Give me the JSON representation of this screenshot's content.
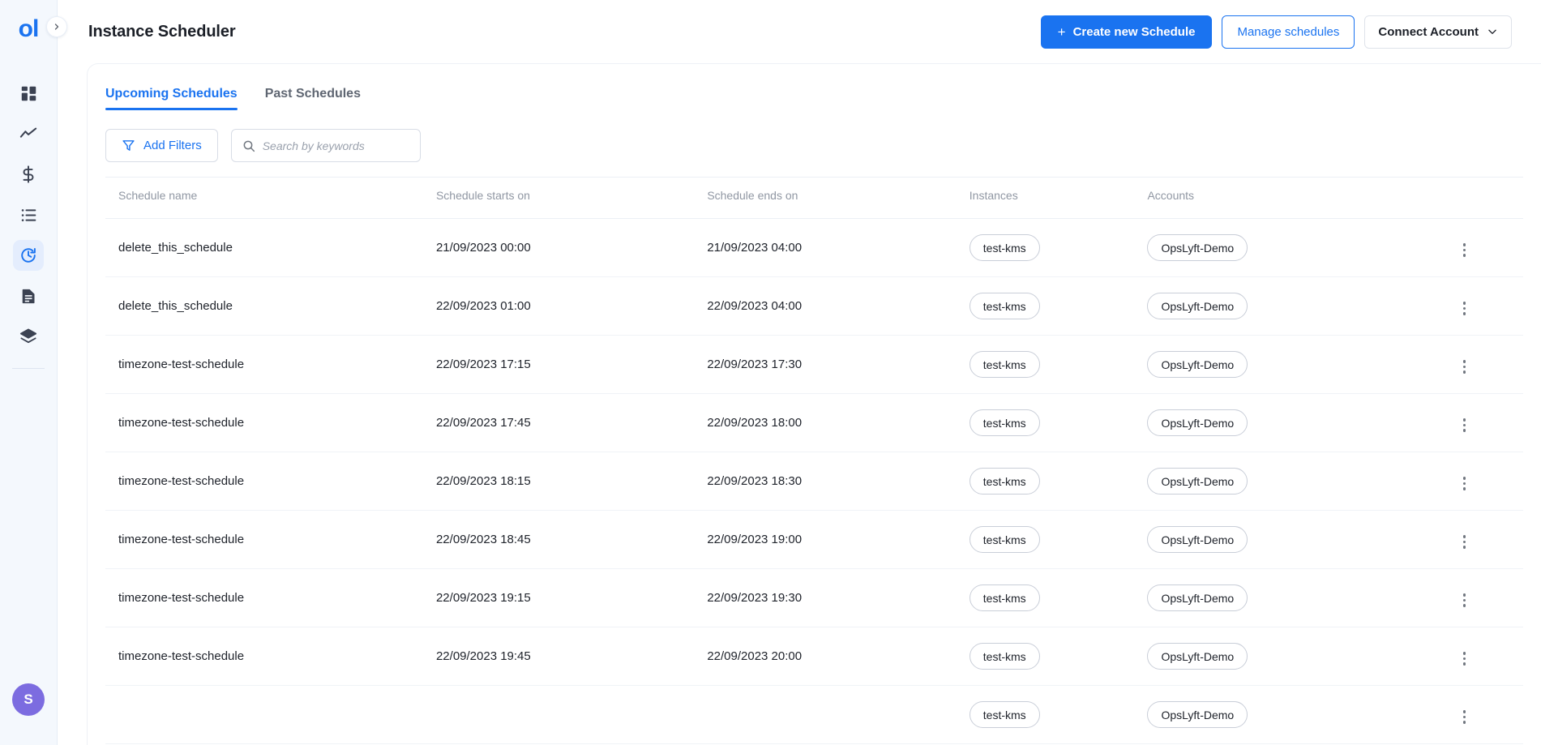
{
  "brand": {
    "logo_text": "ol",
    "expand_icon": "chevron-right-icon"
  },
  "colors": {
    "accent": "#1a73f0",
    "sidebar_bg": "#f4f8fd",
    "active_nav_bg": "#e4edfd",
    "avatar_bg": "#7c6ce0",
    "text": "#20242c",
    "muted": "#9097a3"
  },
  "sidebar": {
    "items": [
      {
        "name": "dashboard",
        "icon": "grid-dashboard-icon",
        "active": false
      },
      {
        "name": "analytics",
        "icon": "trending-line-icon",
        "active": false
      },
      {
        "name": "cost",
        "icon": "dollar-icon",
        "active": false
      },
      {
        "name": "inventory",
        "icon": "list-icon",
        "active": false
      },
      {
        "name": "scheduler",
        "icon": "clock-refresh-icon",
        "active": true
      },
      {
        "name": "reports",
        "icon": "document-icon",
        "active": false
      },
      {
        "name": "resources",
        "icon": "layers-icon",
        "active": false
      }
    ],
    "avatar_initial": "S"
  },
  "header": {
    "title": "Instance Scheduler",
    "create_button": {
      "label": "Create new Schedule",
      "plus": "+"
    },
    "manage_button": {
      "label": "Manage schedules"
    },
    "connect_button": {
      "label": "Connect Account",
      "caret": "chevron-down-icon"
    }
  },
  "tabs": [
    {
      "label": "Upcoming Schedules",
      "active": true
    },
    {
      "label": "Past Schedules",
      "active": false
    }
  ],
  "filters": {
    "add_filters_label": "Add Filters",
    "filter_icon": "funnel-icon",
    "search_icon": "search-icon",
    "search_placeholder": "Search by keywords",
    "search_value": ""
  },
  "table": {
    "columns": [
      "Schedule name",
      "Schedule starts on",
      "Schedule ends on",
      "Instances",
      "Accounts"
    ],
    "rows": [
      {
        "name": "delete_this_schedule",
        "starts_on": "21/09/2023 00:00",
        "ends_on": "21/09/2023 04:00",
        "instance": "test-kms",
        "account": "OpsLyft-Demo"
      },
      {
        "name": "delete_this_schedule",
        "starts_on": "22/09/2023 01:00",
        "ends_on": "22/09/2023 04:00",
        "instance": "test-kms",
        "account": "OpsLyft-Demo"
      },
      {
        "name": "timezone-test-schedule",
        "starts_on": "22/09/2023 17:15",
        "ends_on": "22/09/2023 17:30",
        "instance": "test-kms",
        "account": "OpsLyft-Demo"
      },
      {
        "name": "timezone-test-schedule",
        "starts_on": "22/09/2023 17:45",
        "ends_on": "22/09/2023 18:00",
        "instance": "test-kms",
        "account": "OpsLyft-Demo"
      },
      {
        "name": "timezone-test-schedule",
        "starts_on": "22/09/2023 18:15",
        "ends_on": "22/09/2023 18:30",
        "instance": "test-kms",
        "account": "OpsLyft-Demo"
      },
      {
        "name": "timezone-test-schedule",
        "starts_on": "22/09/2023 18:45",
        "ends_on": "22/09/2023 19:00",
        "instance": "test-kms",
        "account": "OpsLyft-Demo"
      },
      {
        "name": "timezone-test-schedule",
        "starts_on": "22/09/2023 19:15",
        "ends_on": "22/09/2023 19:30",
        "instance": "test-kms",
        "account": "OpsLyft-Demo"
      },
      {
        "name": "timezone-test-schedule",
        "starts_on": "22/09/2023 19:45",
        "ends_on": "22/09/2023 20:00",
        "instance": "test-kms",
        "account": "OpsLyft-Demo"
      },
      {
        "name": "",
        "starts_on": "",
        "ends_on": "",
        "instance": "test-kms",
        "account": "OpsLyft-Demo"
      }
    ],
    "row_menu_icon": "more-vertical-icon"
  }
}
